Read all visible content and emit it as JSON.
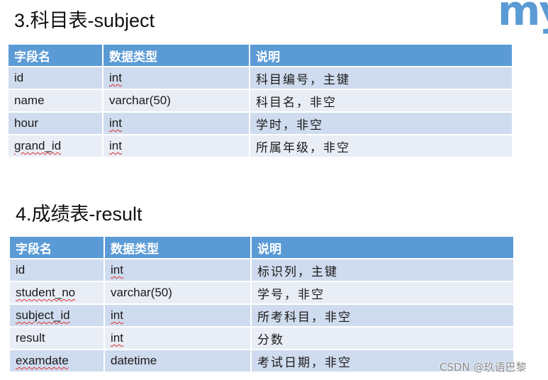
{
  "logo_text": "my",
  "sections": [
    {
      "title": "3.科目表-subject",
      "headers": [
        "字段名",
        "数据类型",
        "说明"
      ],
      "rows": [
        {
          "field": "id",
          "type": "int",
          "desc": "科目编号，主键"
        },
        {
          "field": "name",
          "type": "varchar(50)",
          "desc": "科目名，非空"
        },
        {
          "field": "hour",
          "type": "int",
          "desc": "学时，非空"
        },
        {
          "field": "grand_id",
          "type": "int",
          "desc": "所属年级，非空"
        }
      ]
    },
    {
      "title": "4.成绩表-result",
      "headers": [
        "字段名",
        "数据类型",
        "说明"
      ],
      "rows": [
        {
          "field": "id",
          "type": "int",
          "desc": "标识列，主键"
        },
        {
          "field": "student_no",
          "type": "varchar(50)",
          "desc": "学号，非空"
        },
        {
          "field": "subject_id",
          "type": "int",
          "desc": "所考科目，非空"
        },
        {
          "field": "result",
          "type": "int",
          "desc": "分数"
        },
        {
          "field": "examdate",
          "type": "datetime",
          "desc": "考试日期，非空"
        }
      ]
    }
  ],
  "watermark": "CSDN @玖语巴黎",
  "colors": {
    "header_bg": "#5b9bd5",
    "row_odd_bg": "#cfdbee",
    "row_even_bg": "#e8edf6",
    "logo": "#5b9bd5"
  }
}
